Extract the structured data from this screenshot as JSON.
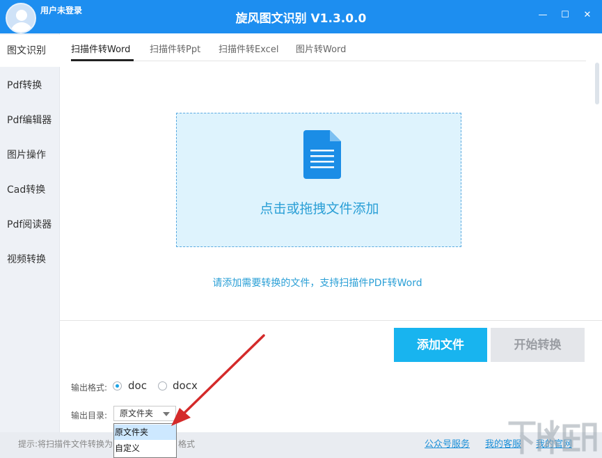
{
  "window": {
    "title": "旋风图文识别 V1.3.0.0",
    "user_label": "用户未登录",
    "min_glyph": "—",
    "max_glyph": "☐",
    "close_glyph": "✕"
  },
  "sidebar": {
    "items": [
      {
        "label": "图文识别",
        "active": true
      },
      {
        "label": "Pdf转换"
      },
      {
        "label": "Pdf编辑器"
      },
      {
        "label": "图片操作"
      },
      {
        "label": "Cad转换"
      },
      {
        "label": "Pdf阅读器"
      },
      {
        "label": "视频转换"
      }
    ]
  },
  "tabs": [
    {
      "label": "扫描件转Word",
      "active": true
    },
    {
      "label": "扫描件转Ppt"
    },
    {
      "label": "扫描件转Excel"
    },
    {
      "label": "图片转Word"
    }
  ],
  "dropzone": {
    "icon": "document-icon",
    "text": "点击或拖拽文件添加"
  },
  "hint": "请添加需要转换的文件，支持扫描件PDF转Word",
  "buttons": {
    "add": "添加文件",
    "start": "开始转换"
  },
  "output_format": {
    "label": "输出格式:",
    "options": [
      "doc",
      "docx"
    ],
    "selected": "doc"
  },
  "output_dir": {
    "label": "输出目录:",
    "selected": "原文件夹",
    "options": [
      "原文件夹",
      "自定义"
    ]
  },
  "statusbar": {
    "tip_left": "提示:将扫描件文件转换为",
    "tip_right": "格式",
    "links": [
      "公众号服务",
      "我的客服",
      "我的官网"
    ]
  },
  "colors": {
    "titlebar": "#1d8ef0",
    "accent": "#18b4ef",
    "dropzone_bg": "#def3fd",
    "annotation_arrow": "#d42a2a"
  }
}
